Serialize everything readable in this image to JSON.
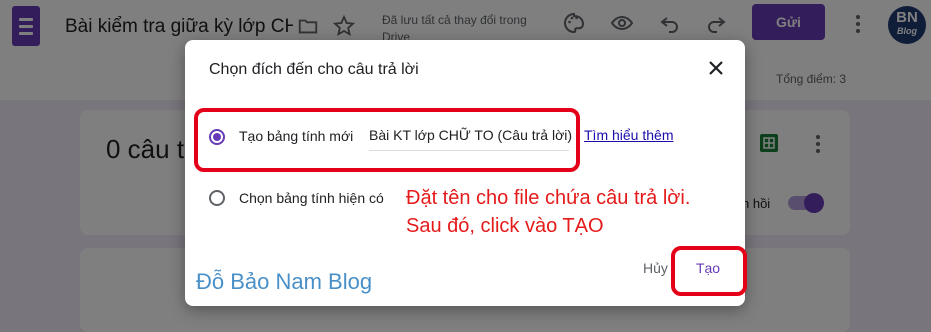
{
  "app": {
    "document_title": "Bài kiểm tra giữa kỳ lớp CHỮ",
    "saved_status": "Đã lưu tất cả thay đổi trong Drive",
    "send_label": "Gửi",
    "avatar_text": [
      "BN",
      "Blog"
    ],
    "total_points": "Tổng điểm: 3",
    "accent_color": "#673ab7"
  },
  "responses_card": {
    "title_partial": "0 câu t",
    "accepting_label_partial": "n hồi",
    "accepting_toggle_on": true
  },
  "dialog": {
    "title": "Chọn đích đến cho câu trả lời",
    "options": [
      {
        "label": "Tạo bảng tính mới",
        "selected": true
      },
      {
        "label": "Chọn bảng tính hiện có",
        "selected": false
      }
    ],
    "spreadsheet_name": "Bài KT lớp CHỮ TO (Câu trả lời)",
    "learn_more": "Tìm hiểu thêm",
    "cancel_label": "Hủy",
    "create_label": "Tạo"
  },
  "annotation": {
    "line1": "Đặt tên cho file chứa câu trả lời.",
    "line2": "Sau đó, click vào TẠO",
    "color": "#e51a1a"
  },
  "watermark": "Đỗ Bảo Nam Blog",
  "icons": [
    "forms-icon",
    "folder-icon",
    "star-icon",
    "palette-icon",
    "eye-icon",
    "undo-icon",
    "redo-icon",
    "more-vert-icon",
    "sheets-icon",
    "close-icon"
  ]
}
